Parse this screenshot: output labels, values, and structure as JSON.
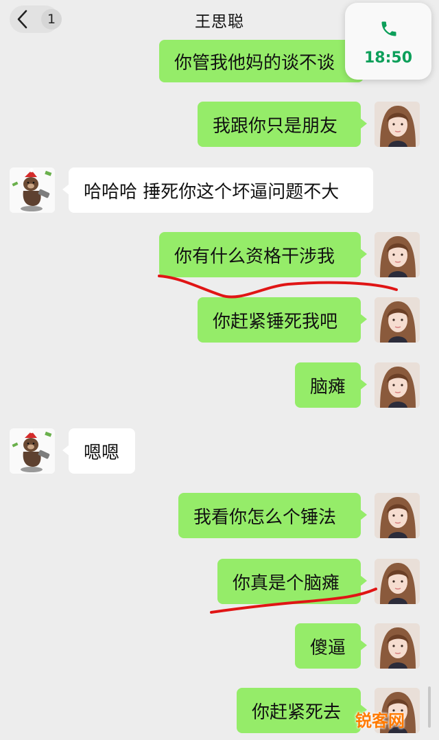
{
  "header": {
    "unread_count": "1",
    "title": "王思聪"
  },
  "call_overlay": {
    "icon": "phone-icon",
    "duration": "18:50"
  },
  "messages": [
    {
      "from": "me",
      "text": "你管我他妈的谈不谈"
    },
    {
      "from": "me",
      "text": "我跟你只是朋友"
    },
    {
      "from": "them",
      "text": "哈哈哈 捶死你这个坏逼问题不大"
    },
    {
      "from": "me",
      "text": "你有什么资格干涉我"
    },
    {
      "from": "me",
      "text": "你赶紧锤死我吧"
    },
    {
      "from": "me",
      "text": "脑瘫"
    },
    {
      "from": "them",
      "text": "嗯嗯"
    },
    {
      "from": "me",
      "text": "我看你怎么个锤法"
    },
    {
      "from": "me",
      "text": "你真是个脑瘫"
    },
    {
      "from": "me",
      "text": "傻逼"
    },
    {
      "from": "me",
      "text": "你赶紧死去"
    }
  ],
  "watermark": "锐客网",
  "colors": {
    "background": "#ededed",
    "my_bubble": "#95ec69",
    "their_bubble": "#ffffff",
    "call_time": "#0d9f5a",
    "annotation": "#e01515"
  }
}
